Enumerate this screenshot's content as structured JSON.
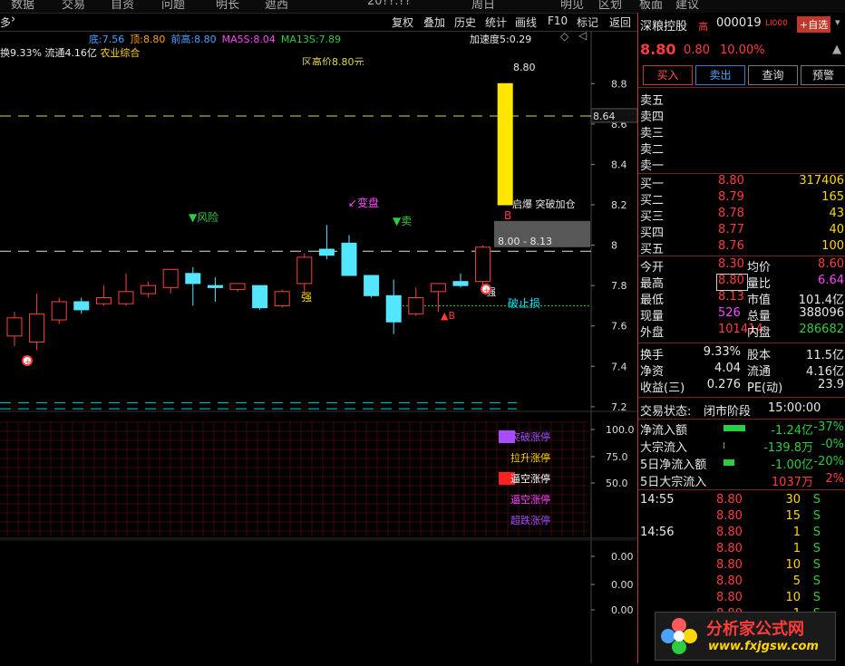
{
  "topbar": {
    "items": [
      "数据",
      "交易",
      "自资",
      "问题",
      "明长",
      "遮西",
      "20??.??",
      "周日",
      "明见",
      "区划",
      "板面",
      "建议"
    ]
  },
  "toolbar": {
    "left_label": "多",
    "items": [
      "复权",
      "叠加",
      "历史",
      "统计",
      "画线",
      "F10",
      "标记",
      "返回"
    ]
  },
  "stock_info": {
    "line1": [
      {
        "label": "底:",
        "value": "7.56",
        "color": "#4aa3ff"
      },
      {
        "label": "顶:",
        "value": "8.80",
        "color": "#ff9f1a"
      },
      {
        "label": "前高:",
        "value": "8.80",
        "color": "#4aa3ff"
      },
      {
        "label": "MA5S:",
        "value": "8.04",
        "color": "#ff44ff"
      },
      {
        "label": "MA13S:",
        "value": "7.89",
        "color": "#2ecc40"
      }
    ],
    "line2": "换9.33% 流通4.16亿",
    "sector": "农业综合",
    "accel": "加速度5:0.29",
    "partial_text": "区高价8.80元"
  },
  "chart_data": {
    "type": "candlestick",
    "y_ticks": [
      8.8,
      8.6,
      8.4,
      8.2,
      8.0,
      7.8,
      7.6,
      7.4,
      7.2
    ],
    "ylim": [
      7.15,
      8.9
    ],
    "current_marker": "8.64",
    "candles": [
      {
        "o": 7.55,
        "c": 7.64,
        "h": 7.67,
        "l": 7.5
      },
      {
        "o": 7.52,
        "c": 7.66,
        "h": 7.76,
        "l": 7.48
      },
      {
        "o": 7.63,
        "c": 7.72,
        "h": 7.74,
        "l": 7.61
      },
      {
        "o": 7.72,
        "c": 7.68,
        "h": 7.74,
        "l": 7.66
      },
      {
        "o": 7.71,
        "c": 7.74,
        "h": 7.8,
        "l": 7.7
      },
      {
        "o": 7.71,
        "c": 7.77,
        "h": 7.86,
        "l": 7.7
      },
      {
        "o": 7.76,
        "c": 7.8,
        "h": 7.82,
        "l": 7.74
      },
      {
        "o": 7.79,
        "c": 7.88,
        "h": 7.88,
        "l": 7.76
      },
      {
        "o": 7.86,
        "c": 7.81,
        "h": 7.89,
        "l": 7.7
      },
      {
        "o": 7.8,
        "c": 7.79,
        "h": 7.84,
        "l": 7.72
      },
      {
        "o": 7.78,
        "c": 7.81,
        "h": 7.81,
        "l": 7.77
      },
      {
        "o": 7.8,
        "c": 7.69,
        "h": 7.8,
        "l": 7.68
      },
      {
        "o": 7.7,
        "c": 7.77,
        "h": 7.78,
        "l": 7.69
      },
      {
        "o": 7.81,
        "c": 7.94,
        "h": 7.96,
        "l": 7.76
      },
      {
        "o": 7.98,
        "c": 7.95,
        "h": 8.1,
        "l": 7.93
      },
      {
        "o": 8.01,
        "c": 7.85,
        "h": 8.05,
        "l": 7.85
      },
      {
        "o": 7.85,
        "c": 7.75,
        "h": 7.85,
        "l": 7.74
      },
      {
        "o": 7.75,
        "c": 7.62,
        "h": 7.83,
        "l": 7.56
      },
      {
        "o": 7.66,
        "c": 7.74,
        "h": 7.79,
        "l": 7.65
      },
      {
        "o": 7.77,
        "c": 7.81,
        "h": 7.81,
        "l": 7.67
      },
      {
        "o": 7.82,
        "c": 7.8,
        "h": 7.86,
        "l": 7.79
      },
      {
        "o": 7.82,
        "c": 7.99,
        "h": 8.0,
        "l": 7.78
      },
      {
        "o": 8.2,
        "c": 8.8,
        "h": 8.8,
        "l": 8.2
      }
    ],
    "hlines": [
      {
        "y": 8.64,
        "color": "#e6d44a",
        "style": "dash"
      },
      {
        "y": 7.97,
        "color": "#e0e0e0",
        "style": "dash"
      },
      {
        "y": 7.7,
        "color": "#2ecc40",
        "style": "dot"
      },
      {
        "y": 7.22,
        "color": "#00d0d0",
        "style": "dash"
      },
      {
        "y": 7.19,
        "color": "#00d0d0",
        "style": "dash"
      }
    ],
    "annotations": [
      {
        "text": "▼风险",
        "color": "#2ecc40"
      },
      {
        "text": "↙变盘",
        "color": "#ff44ff"
      },
      {
        "text": "▼卖",
        "color": "#2ecc40"
      },
      {
        "text": "强",
        "color": "#ffd700"
      },
      {
        "text": "强",
        "color": "#e8e8e8"
      },
      {
        "text": "▲B",
        "color": "#ff3b3b"
      },
      {
        "text": "破止损",
        "color": "#00e5ff"
      },
      {
        "text": "8.00 - 8.13",
        "color": "#e8e8e8"
      },
      {
        "text": "8.80",
        "color": "#e8e8e8"
      },
      {
        "text": "启爆 突破加仓",
        "color": "#e8e8e8"
      },
      {
        "text": "B",
        "color": "#ff3b3b"
      }
    ],
    "indicator": {
      "y_ticks": [
        "100.0",
        "75.0",
        "50.0"
      ],
      "legend": [
        {
          "label": "突破涨停",
          "color": "#a64dff"
        },
        {
          "label": "拉升涨停",
          "color": "#ffd700"
        },
        {
          "label": "逼空涨停",
          "color": "#ff2020"
        },
        {
          "label": "逼空涨停",
          "color": "#ff44ff"
        },
        {
          "label": "超跌涨停",
          "color": "#a64dff"
        }
      ]
    },
    "volume": {
      "y_ticks": [
        "0.00",
        "0.00",
        "0.00"
      ]
    }
  },
  "quote": {
    "name": "深粮控股",
    "tag": "高",
    "code": "000019",
    "market": "LI000",
    "add_btn": "+自选",
    "price": "8.80",
    "change": "0.80",
    "pct": "10.00%",
    "buttons": [
      "买入",
      "卖出",
      "查询",
      "预警"
    ],
    "sell": [
      "卖五",
      "卖四",
      "卖三",
      "卖二",
      "卖一"
    ],
    "buy": [
      {
        "label": "买一",
        "price": "8.80",
        "vol": "317406"
      },
      {
        "label": "买二",
        "price": "8.79",
        "vol": "165"
      },
      {
        "label": "买三",
        "price": "8.78",
        "vol": "43"
      },
      {
        "label": "买四",
        "price": "8.77",
        "vol": "40"
      },
      {
        "label": "买五",
        "price": "8.76",
        "vol": "100"
      }
    ],
    "stats1": [
      {
        "l1": "今开",
        "v1": "8.30",
        "c1": "red",
        "l2": "均价",
        "v2": "8.60",
        "c2": "red"
      },
      {
        "l1": "最高",
        "v1": "8.80",
        "c1": "red",
        "l2": "量比",
        "v2": "6.64",
        "c2": "magenta"
      },
      {
        "l1": "最低",
        "v1": "8.13",
        "c1": "red",
        "l2": "市值",
        "v2": "101.4亿",
        "c2": "white"
      },
      {
        "l1": "现量",
        "v1": "526",
        "c1": "magenta",
        "l2": "总量",
        "v2": "388096",
        "c2": "white"
      },
      {
        "l1": "外盘",
        "v1": "101414",
        "c1": "red",
        "l2": "内盘",
        "v2": "286682",
        "c2": "green"
      }
    ],
    "stats2": [
      {
        "l1": "换手",
        "v1": "9.33%",
        "c1": "white",
        "l2": "股本",
        "v2": "11.5亿",
        "c2": "white"
      },
      {
        "l1": "净资",
        "v1": "4.04",
        "c1": "white",
        "l2": "流通",
        "v2": "4.16亿",
        "c2": "white"
      },
      {
        "l1": "收益(三)",
        "v1": "0.276",
        "c1": "white",
        "l2": "PE(动)",
        "v2": "23.9",
        "c2": "white"
      }
    ],
    "trade_status_label": "交易状态:",
    "trade_status": "闭市阶段",
    "trade_time": "15:00:00",
    "flows": [
      {
        "label": "净流入额",
        "value": "-1.24亿",
        "pct": "-37%",
        "bar": 0.6
      },
      {
        "label": "大宗流入",
        "value": "-139.8万",
        "pct": "-0%",
        "bar": 0.02
      },
      {
        "label": "5日净流入额",
        "value": "-1.00亿",
        "pct": "-20%",
        "bar": 0.3
      },
      {
        "label": "5日大宗流入",
        "value": "1037万",
        "pct": "2%",
        "bar": 0.0
      }
    ],
    "ticks": [
      {
        "time": "14:55",
        "price": "8.80",
        "vol": "30",
        "side": "S"
      },
      {
        "time": "",
        "price": "8.80",
        "vol": "15",
        "side": "S"
      },
      {
        "time": "14:56",
        "price": "8.80",
        "vol": "1",
        "side": "S"
      },
      {
        "time": "",
        "price": "8.80",
        "vol": "1",
        "side": "S"
      },
      {
        "time": "",
        "price": "8.80",
        "vol": "10",
        "side": "S"
      },
      {
        "time": "",
        "price": "8.80",
        "vol": "5",
        "side": "S"
      },
      {
        "time": "",
        "price": "8.80",
        "vol": "10",
        "side": "S"
      },
      {
        "time": "",
        "price": "8.80",
        "vol": "1",
        "side": "S"
      }
    ]
  },
  "watermark": {
    "title": "分析家公式网",
    "url": "www.fxjgsw.com"
  }
}
